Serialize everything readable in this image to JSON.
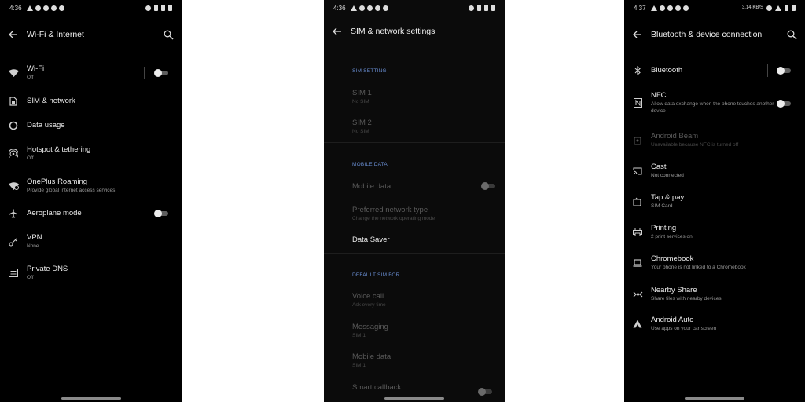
{
  "screen1": {
    "status": {
      "time": "4:36"
    },
    "title": "Wi-Fi & Internet",
    "items": [
      {
        "title": "Wi-Fi",
        "subtitle": "Off",
        "icon": "wifi-icon"
      },
      {
        "title": "SIM & network",
        "subtitle": "",
        "icon": "sim-card-icon"
      },
      {
        "title": "Data usage",
        "subtitle": "",
        "icon": "data-usage-icon"
      },
      {
        "title": "Hotspot & tethering",
        "subtitle": "Off",
        "icon": "hotspot-icon"
      },
      {
        "title": "OnePlus Roaming",
        "subtitle": "Provide global internet access services",
        "icon": "roaming-icon"
      },
      {
        "title": "Aeroplane mode",
        "subtitle": "",
        "icon": "airplane-icon"
      },
      {
        "title": "VPN",
        "subtitle": "None",
        "icon": "vpn-key-icon"
      },
      {
        "title": "Private DNS",
        "subtitle": "Off",
        "icon": "dns-icon"
      }
    ]
  },
  "screen2": {
    "status": {
      "time": "4:36"
    },
    "title": "SIM & network settings",
    "sections": [
      "SIM SETTING",
      "MOBILE DATA",
      "DEFAULT SIM FOR"
    ],
    "items": [
      {
        "title": "SIM 1",
        "subtitle": "No SIM"
      },
      {
        "title": "SIM 2",
        "subtitle": "No SIM"
      },
      {
        "title": "Mobile data",
        "subtitle": ""
      },
      {
        "title": "Preferred network type",
        "subtitle": "Change the network operating mode"
      },
      {
        "title": "Data Saver",
        "subtitle": ""
      },
      {
        "title": "Voice call",
        "subtitle": "Ask every time"
      },
      {
        "title": "Messaging",
        "subtitle": "SIM 1"
      },
      {
        "title": "Mobile data",
        "subtitle": "SIM 1"
      },
      {
        "title": "Smart callback",
        "subtitle": ""
      }
    ]
  },
  "screen3": {
    "status": {
      "time": "4:37",
      "network": "3.14 KB/S"
    },
    "title": "Bluetooth & device connection",
    "items": [
      {
        "title": "Bluetooth",
        "subtitle": "",
        "icon": "bluetooth-icon"
      },
      {
        "title": "NFC",
        "subtitle": "Allow data exchange when the phone touches another device",
        "icon": "nfc-icon"
      },
      {
        "title": "Android Beam",
        "subtitle": "Unavailable because NFC is turned off",
        "icon": "android-beam-icon"
      },
      {
        "title": "Cast",
        "subtitle": "Not connected",
        "icon": "cast-icon"
      },
      {
        "title": "Tap & pay",
        "subtitle": "SIM Card",
        "icon": "tap-pay-icon"
      },
      {
        "title": "Printing",
        "subtitle": "2 print services on",
        "icon": "printer-icon"
      },
      {
        "title": "Chromebook",
        "subtitle": "Your phone is not linked to a Chromebook",
        "icon": "chromebook-icon"
      },
      {
        "title": "Nearby Share",
        "subtitle": "Share files with nearby devices",
        "icon": "nearby-share-icon"
      },
      {
        "title": "Android Auto",
        "subtitle": "Use apps on your car screen",
        "icon": "android-auto-icon"
      }
    ]
  },
  "colors": {
    "background": "#000000",
    "accent": "#6a8fd4",
    "text": "#eaeaea",
    "subtext": "#9a9a9a"
  }
}
